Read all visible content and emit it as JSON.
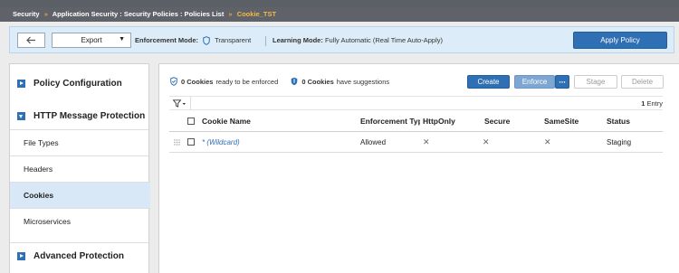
{
  "breadcrumb": {
    "items": [
      "Security",
      "Application Security : Security Policies : Policies List",
      "Cookie_TST"
    ],
    "separator": "»"
  },
  "toolbar": {
    "export_label": "Export",
    "enforcement_label": "Enforcement Mode:",
    "enforcement_value": "Transparent",
    "learning_label": "Learning Mode:",
    "learning_value": "Fully Automatic (Real Time Auto-Apply)",
    "apply_label": "Apply Policy"
  },
  "sidebar": {
    "policy_config": "Policy Configuration",
    "http_protection": "HTTP Message Protection",
    "items": [
      {
        "label": "File Types"
      },
      {
        "label": "Headers"
      },
      {
        "label": "Cookies",
        "active": true
      },
      {
        "label": "Microservices"
      }
    ],
    "advanced_protection": "Advanced Protection"
  },
  "main": {
    "stat1_count": "0 Cookies",
    "stat1_text": "ready to be enforced",
    "stat2_count": "0 Cookies",
    "stat2_text": "have suggestions",
    "create_label": "Create",
    "enforce_label": "Enforce",
    "more_label": "···",
    "stage_label": "Stage",
    "delete_label": "Delete",
    "entry_count": "1",
    "entry_label": "Entry"
  },
  "table": {
    "headers": {
      "name": "Cookie Name",
      "enforcement": "Enforcement Type",
      "httponly": "HttpOnly",
      "secure": "Secure",
      "samesite": "SameSite",
      "status": "Status"
    },
    "rows": [
      {
        "name": "* (Wildcard)",
        "enforcement": "Allowed",
        "httponly": "✕",
        "secure": "✕",
        "samesite": "✕",
        "status": "Staging"
      }
    ]
  },
  "colors": {
    "accent": "#2f6fb4",
    "breadcrumb_current": "#f4b942",
    "toolbar_bg": "#dcecf8",
    "active_item_bg": "#d9e8f6"
  }
}
